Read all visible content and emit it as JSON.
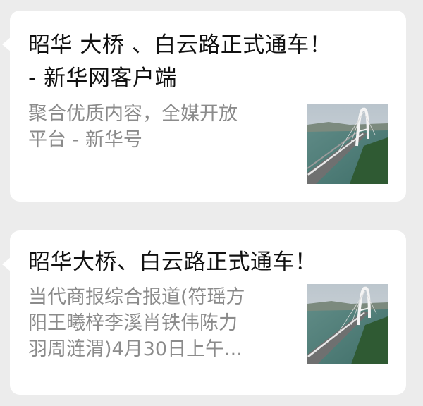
{
  "cards": [
    {
      "title_line1": "昭华 大桥 、白云路正式通车！",
      "title_line2": " - 新华网客户端",
      "desc_line1": "聚合优质内容，全媒开放",
      "desc_line2": "平台 - 新华号",
      "thumbnail_icon": "bridge-photo-icon"
    },
    {
      "title_line1": "昭华大桥、白云路正式通车！",
      "desc_line1": "当代商报综合报道(符瑶方",
      "desc_line2": "阳王曦梓李溪肖铁伟陈力",
      "desc_line3": "羽周涟渭)4月30日上午...",
      "thumbnail_icon": "bridge-photo-icon"
    }
  ]
}
